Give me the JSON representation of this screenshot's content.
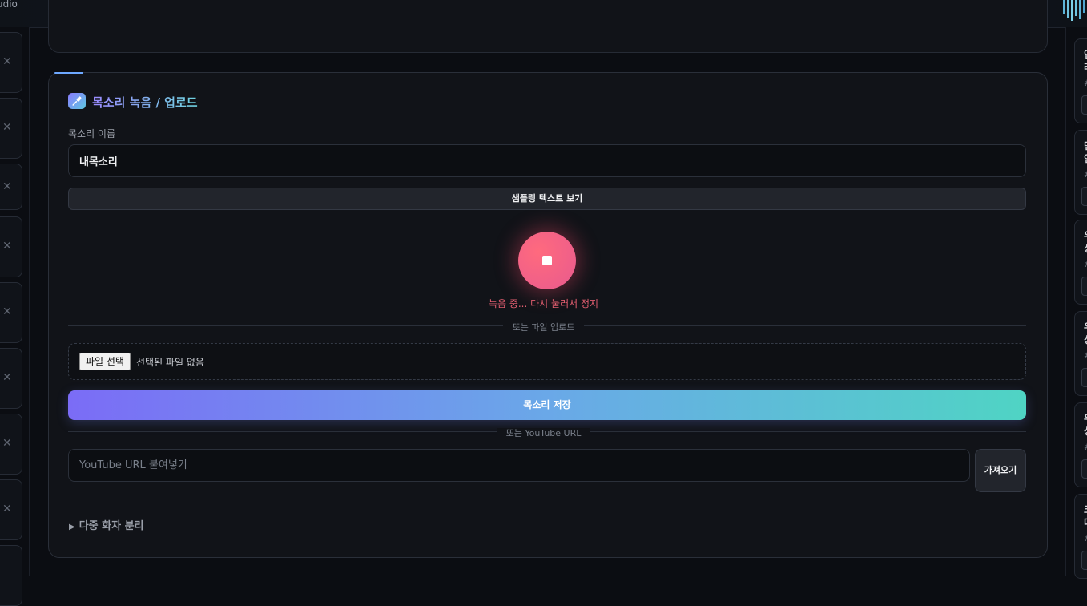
{
  "app": {
    "title_fragment": "udio"
  },
  "left_rail": {
    "close_glyph": "✕",
    "card_count": 8
  },
  "right_rail": {
    "cards": [
      {
        "l1": "인",
        "l2": "라",
        "hash": "#"
      },
      {
        "l1": "먼",
        "l2": "인",
        "hash": "#"
      },
      {
        "l1": "우",
        "l2": "싱",
        "hash": "#"
      },
      {
        "l1": "우",
        "l2": "싱",
        "hash": "#"
      },
      {
        "l1": "우",
        "l2": "싱",
        "hash": "#"
      },
      {
        "l1": "크",
        "l2": "다",
        "hash": "#"
      }
    ]
  },
  "voice_section": {
    "title": "목소리 녹음 / 업로드",
    "icon": "microphone-icon",
    "name_label": "목소리 이름",
    "name_value": "내목소리",
    "sample_button": "샘플링 텍스트 보기",
    "record_status": "녹음 중... 다시 눌러서 정지",
    "divider_file": "또는 파일 업로드",
    "file_button": "파일 선택",
    "file_none": "선택된 파일 없음",
    "save_button": "목소리 저장",
    "divider_youtube": "또는 YouTube URL",
    "youtube_placeholder": "YouTube URL 붙여넣기",
    "fetch_button": "가져오기",
    "multi_speaker": "다중 화자 분리",
    "multi_marker": "▶"
  },
  "colors": {
    "accent_purple": "#7b6cf6",
    "accent_teal": "#4fd4c4",
    "record_red": "#e85a8e",
    "status_red": "#e05d6f"
  }
}
